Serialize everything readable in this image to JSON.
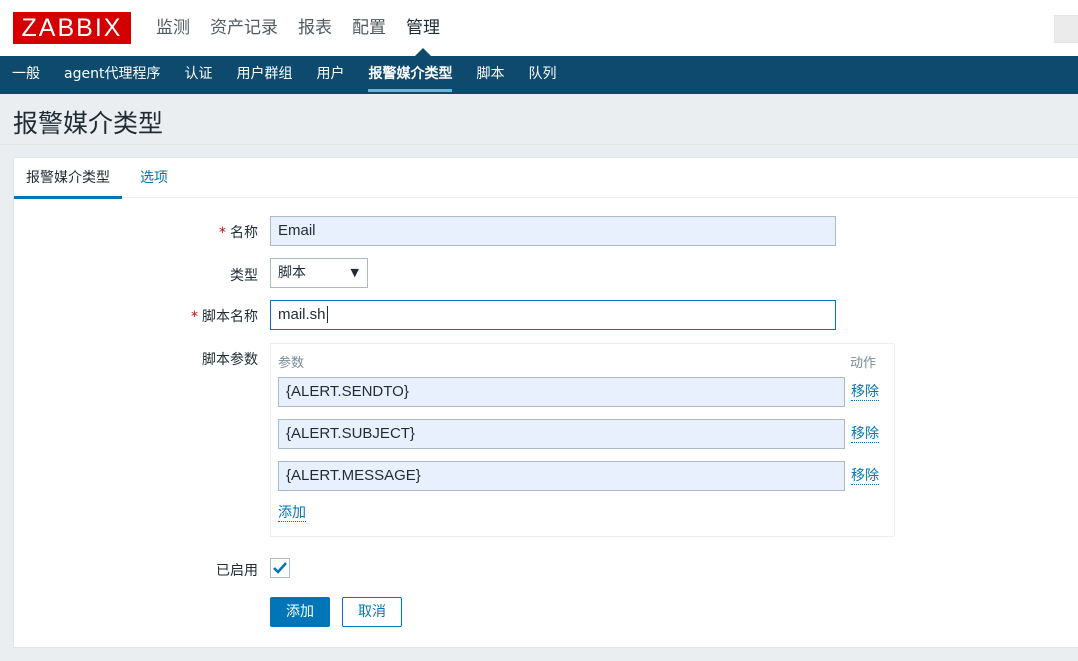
{
  "header": {
    "logo": "ZABBIX",
    "main_menu": [
      "监测",
      "资产记录",
      "报表",
      "配置",
      "管理"
    ],
    "active_main": "管理"
  },
  "submenu": {
    "items": [
      "一般",
      "agent代理程序",
      "认证",
      "用户群组",
      "用户",
      "报警媒介类型",
      "脚本",
      "队列"
    ],
    "active": "报警媒介类型"
  },
  "page": {
    "title": "报警媒介类型"
  },
  "tabs": [
    "报警媒介类型",
    "选项"
  ],
  "form": {
    "required_mark": "*",
    "name_label": "名称",
    "name_value": "Email",
    "type_label": "类型",
    "type_value": "脚本",
    "type_arrow": "▼",
    "script_name_label": "脚本名称",
    "script_name_value": "mail.sh",
    "script_params_label": "脚本参数",
    "params_header": "参数",
    "actions_header": "动作",
    "params": [
      "{ALERT.SENDTO}",
      "{ALERT.SUBJECT}",
      "{ALERT.MESSAGE}"
    ],
    "remove_label": "移除",
    "add_link": "添加",
    "enabled_label": "已启用",
    "enabled": true,
    "submit_label": "添加",
    "cancel_label": "取消"
  },
  "colors": {
    "brand": "#d40000",
    "navbar": "#0e4a6e",
    "accent": "#0275b8"
  }
}
